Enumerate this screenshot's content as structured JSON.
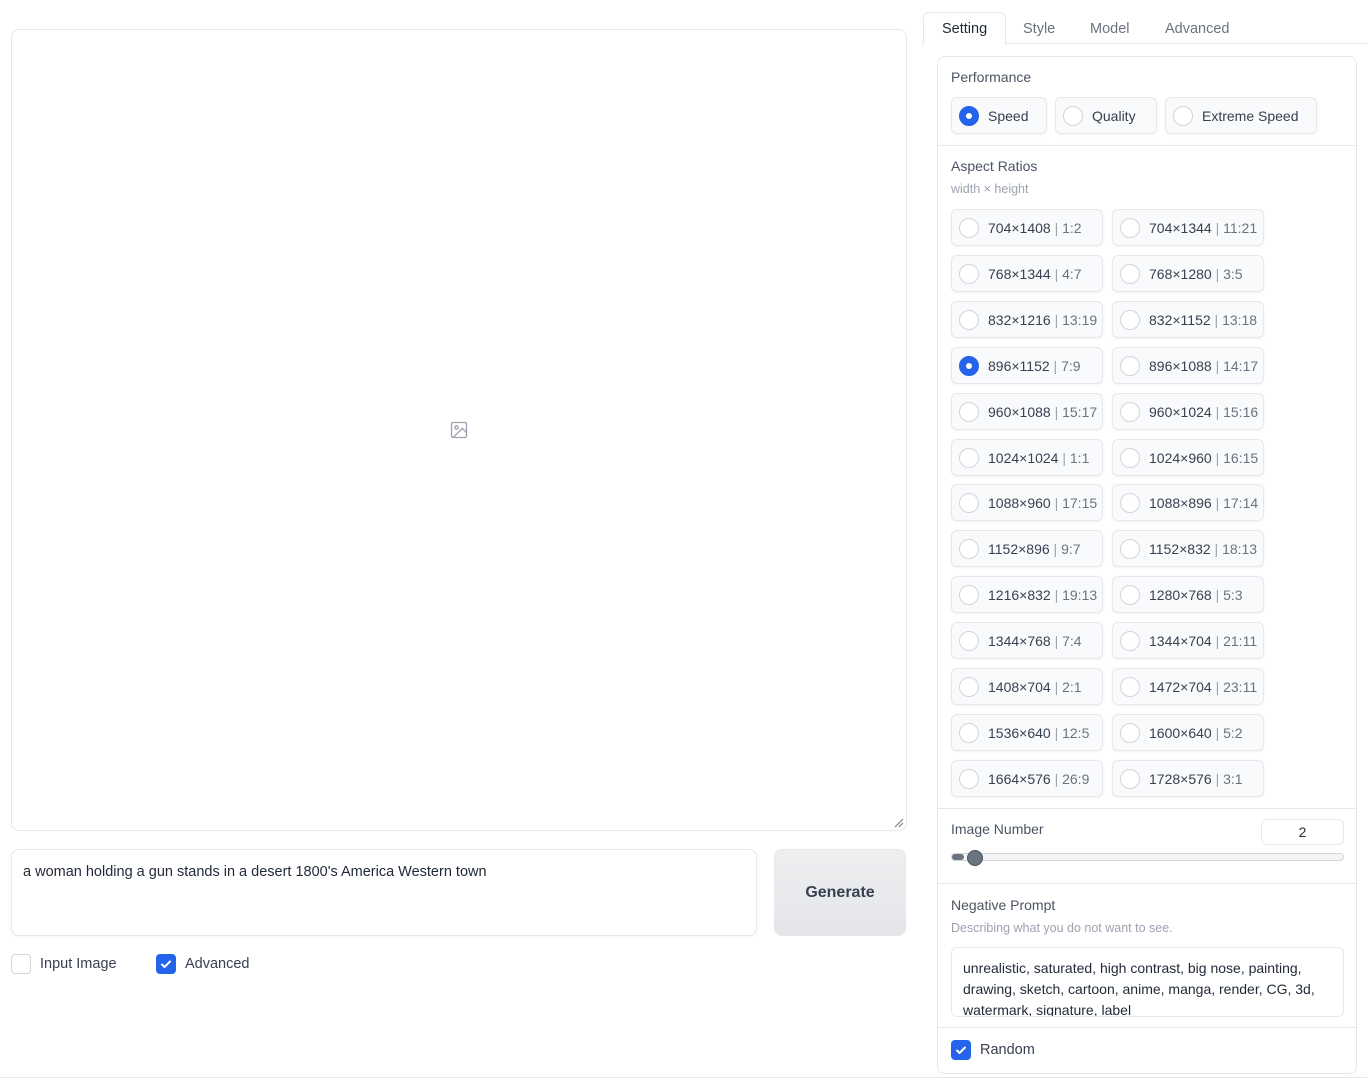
{
  "gallery": {
    "icon": "image-icon"
  },
  "prompt": {
    "value": "a woman holding a gun stands in a desert 1800's America Western town"
  },
  "generate": {
    "label": "Generate"
  },
  "options": {
    "input_image": {
      "label": "Input Image",
      "checked": false
    },
    "advanced": {
      "label": "Advanced",
      "checked": true
    }
  },
  "tabs": [
    {
      "label": "Setting",
      "active": true
    },
    {
      "label": "Style",
      "active": false
    },
    {
      "label": "Model",
      "active": false
    },
    {
      "label": "Advanced",
      "active": false
    }
  ],
  "performance": {
    "label": "Performance",
    "options": [
      {
        "label": "Speed",
        "selected": true
      },
      {
        "label": "Quality",
        "selected": false
      },
      {
        "label": "Extreme Speed",
        "selected": false
      }
    ]
  },
  "aspect_ratios": {
    "label": "Aspect Ratios",
    "sublabel": "width × height",
    "options": [
      {
        "size": "704×1408",
        "ratio": "1:2",
        "selected": false
      },
      {
        "size": "704×1344",
        "ratio": "11:21",
        "selected": false
      },
      {
        "size": "768×1344",
        "ratio": "4:7",
        "selected": false
      },
      {
        "size": "768×1280",
        "ratio": "3:5",
        "selected": false
      },
      {
        "size": "832×1216",
        "ratio": "13:19",
        "selected": false
      },
      {
        "size": "832×1152",
        "ratio": "13:18",
        "selected": false
      },
      {
        "size": "896×1152",
        "ratio": "7:9",
        "selected": true
      },
      {
        "size": "896×1088",
        "ratio": "14:17",
        "selected": false
      },
      {
        "size": "960×1088",
        "ratio": "15:17",
        "selected": false
      },
      {
        "size": "960×1024",
        "ratio": "15:16",
        "selected": false
      },
      {
        "size": "1024×1024",
        "ratio": "1:1",
        "selected": false
      },
      {
        "size": "1024×960",
        "ratio": "16:15",
        "selected": false
      },
      {
        "size": "1088×960",
        "ratio": "17:15",
        "selected": false
      },
      {
        "size": "1088×896",
        "ratio": "17:14",
        "selected": false
      },
      {
        "size": "1152×896",
        "ratio": "9:7",
        "selected": false
      },
      {
        "size": "1152×832",
        "ratio": "18:13",
        "selected": false
      },
      {
        "size": "1216×832",
        "ratio": "19:13",
        "selected": false
      },
      {
        "size": "1280×768",
        "ratio": "5:3",
        "selected": false
      },
      {
        "size": "1344×768",
        "ratio": "7:4",
        "selected": false
      },
      {
        "size": "1344×704",
        "ratio": "21:11",
        "selected": false
      },
      {
        "size": "1408×704",
        "ratio": "2:1",
        "selected": false
      },
      {
        "size": "1472×704",
        "ratio": "23:11",
        "selected": false
      },
      {
        "size": "1536×640",
        "ratio": "12:5",
        "selected": false
      },
      {
        "size": "1600×640",
        "ratio": "5:2",
        "selected": false
      },
      {
        "size": "1664×576",
        "ratio": "26:9",
        "selected": false
      },
      {
        "size": "1728×576",
        "ratio": "3:1",
        "selected": false
      }
    ]
  },
  "image_number": {
    "label": "Image Number",
    "value": "2",
    "fraction": 0.03
  },
  "negative_prompt": {
    "label": "Negative Prompt",
    "sublabel": "Describing what you do not want to see.",
    "value": "unrealistic, saturated, high contrast, big nose, painting, drawing, sketch, cartoon, anime, manga, render, CG, 3d, watermark, signature, label"
  },
  "random": {
    "label": "Random",
    "checked": true
  },
  "colors": {
    "accent": "#2563eb",
    "border": "#e5e7eb"
  }
}
